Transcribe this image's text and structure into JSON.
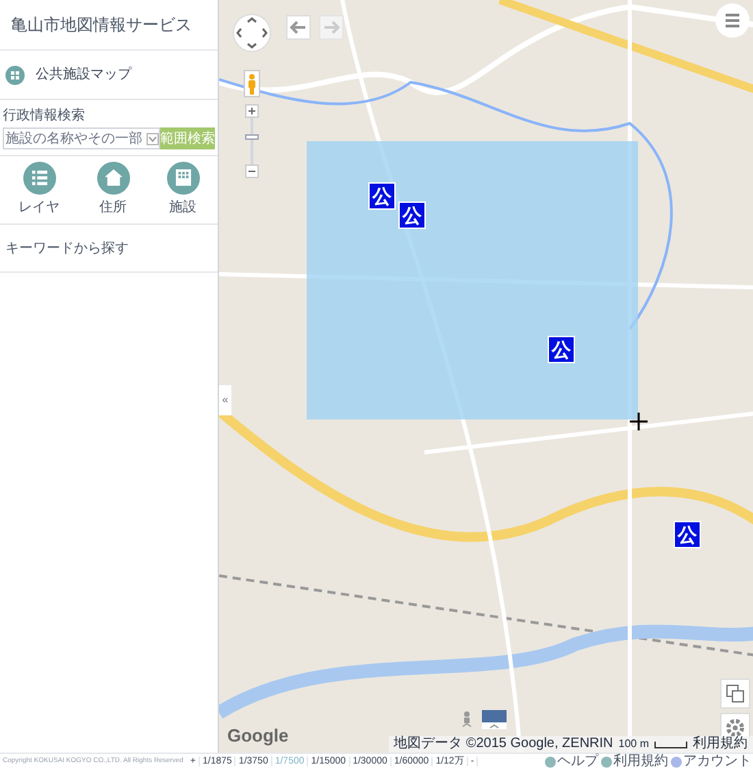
{
  "header": {
    "title": "亀山市地図情報サービス"
  },
  "menu": {
    "title": "公共施設マップ"
  },
  "search": {
    "label": "行政情報検索",
    "placeholder": "施設の名称やその一部",
    "button": "範囲検索"
  },
  "shortcuts": [
    {
      "label": "レイヤ",
      "kind": "list"
    },
    {
      "label": "住所",
      "kind": "house"
    },
    {
      "label": "施設",
      "kind": "building"
    }
  ],
  "keyword": "キーワードから探す",
  "map": {
    "markers": [
      {
        "label": "公"
      },
      {
        "label": "公"
      },
      {
        "label": "公"
      },
      {
        "label": "公"
      }
    ],
    "zoom": {
      "level": 0.6
    },
    "collapse": "«",
    "logo": "Google",
    "attribution": "地図データ ©2015 Google, ZENRIN",
    "scale": "100 m",
    "terms": "利用規約"
  },
  "copyright": "Copyright KOKUSAI KOGYO CO.,LTD. All Rights Reserved",
  "scales": [
    {
      "label": "+",
      "selected": false
    },
    {
      "label": "1/1875",
      "selected": false
    },
    {
      "label": "1/3750",
      "selected": false
    },
    {
      "label": "1/7500",
      "selected": true
    },
    {
      "label": "1/15000",
      "selected": false
    },
    {
      "label": "1/30000",
      "selected": false
    },
    {
      "label": "1/60000",
      "selected": false
    },
    {
      "label": "1/12万",
      "selected": false
    },
    {
      "label": "-",
      "selected": false
    }
  ],
  "links": [
    {
      "label": "ヘルプ"
    },
    {
      "label": "利用規約"
    },
    {
      "label": "アカウント"
    }
  ]
}
